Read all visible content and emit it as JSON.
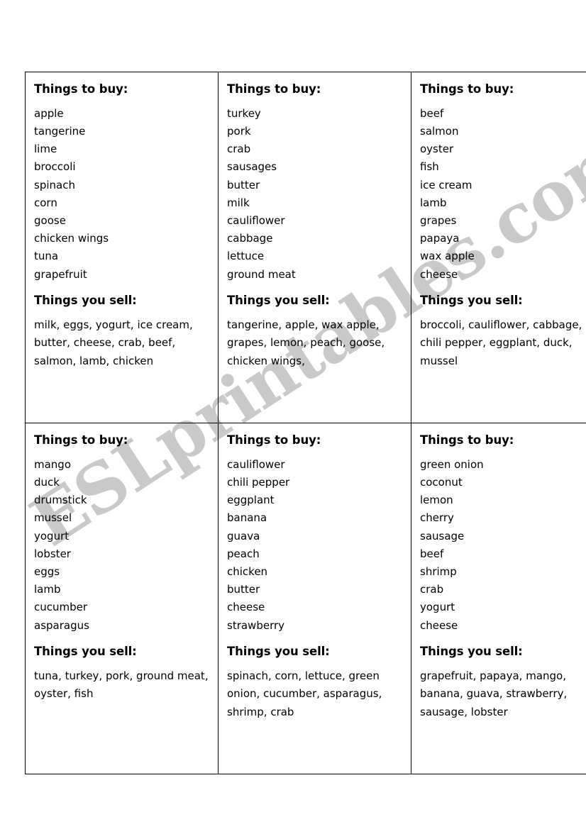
{
  "watermark": {
    "text": "ESLprintables.com",
    "color": "#c9c9c9"
  },
  "labels": {
    "buy_heading": "Things to buy:",
    "sell_heading": "Things you sell:"
  },
  "cards": [
    {
      "id": "card-1",
      "buy_heading": "Things to buy:",
      "buy_items": [
        "apple",
        "tangerine",
        "lime",
        "broccoli",
        "spinach",
        "corn",
        "goose",
        "chicken wings",
        "tuna",
        "grapefruit"
      ],
      "sell_heading": "Things you sell:",
      "sell_items": "milk, eggs, yogurt, ice cream, butter, cheese, crab, beef, salmon, lamb, chicken"
    },
    {
      "id": "card-2",
      "buy_heading": "Things to buy:",
      "buy_items": [
        "turkey",
        "pork",
        "crab",
        "sausages",
        "butter",
        "milk",
        "cauliflower",
        "cabbage",
        "lettuce",
        "ground meat"
      ],
      "sell_heading": "Things you sell:",
      "sell_items": "tangerine, apple, wax apple, grapes, lemon, peach, goose, chicken wings,"
    },
    {
      "id": "card-3",
      "buy_heading": "Things to buy:",
      "buy_items": [
        "beef",
        "salmon",
        "oyster",
        "fish",
        "ice cream",
        "lamb",
        "grapes",
        "papaya",
        "wax apple",
        "cheese"
      ],
      "sell_heading": "Things you sell:",
      "sell_items": "broccoli, cauliflower, cabbage, chili pepper, eggplant, duck, mussel"
    },
    {
      "id": "card-4",
      "buy_heading": "Things to buy:",
      "buy_items": [
        "mango",
        "duck",
        "drumstick",
        "mussel",
        "yogurt",
        "lobster",
        "eggs",
        "lamb",
        "cucumber",
        "asparagus"
      ],
      "sell_heading": "Things you sell:",
      "sell_items": "tuna, turkey, pork, ground meat, oyster, fish"
    },
    {
      "id": "card-5",
      "buy_heading": "Things to buy:",
      "buy_items": [
        "cauliflower",
        "chili pepper",
        "eggplant",
        "banana",
        "guava",
        "peach",
        "chicken",
        "butter",
        "cheese",
        "strawberry"
      ],
      "sell_heading": "Things you sell:",
      "sell_items": "spinach, corn, lettuce, green onion, cucumber, asparagus, shrimp, crab"
    },
    {
      "id": "card-6",
      "buy_heading": "Things to buy:",
      "buy_items": [
        "green onion",
        "coconut",
        "lemon",
        "cherry",
        "sausage",
        "beef",
        "shrimp",
        "crab",
        "yogurt",
        "cheese"
      ],
      "sell_heading": "Things you sell:",
      "sell_items": "grapefruit, papaya, mango, banana, guava, strawberry, sausage, lobster"
    }
  ]
}
